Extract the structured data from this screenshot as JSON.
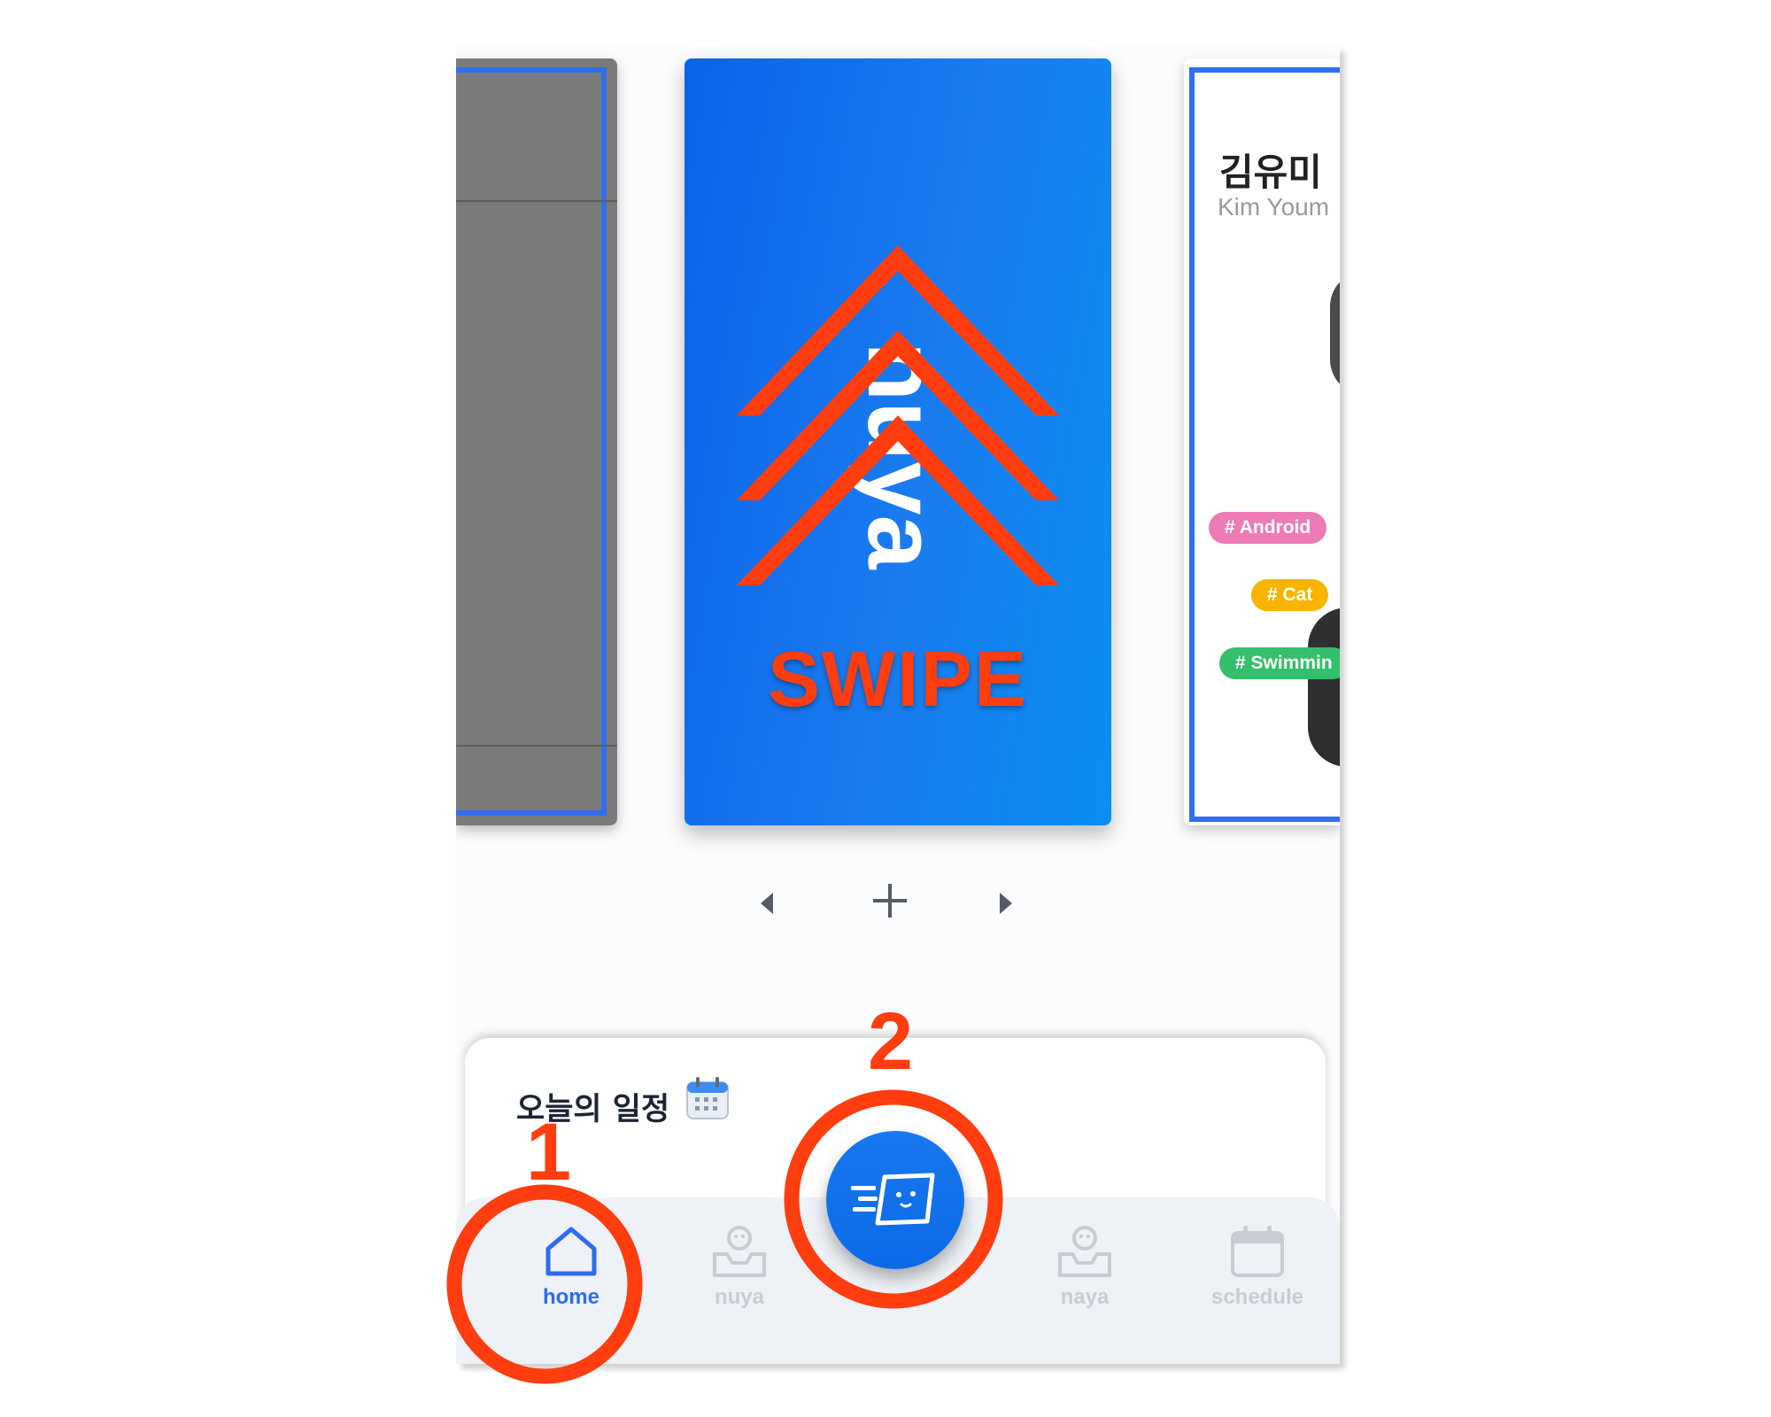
{
  "cards": {
    "center": {
      "wordmark": "nuya",
      "swipe_label": "SWIPE"
    },
    "right": {
      "name_ko": "김유미",
      "name_en": "Kim Youm",
      "tags": [
        "# Android",
        "# Cat",
        "# Swimmin"
      ]
    }
  },
  "controls": {
    "prev_icon": "caret-left-icon",
    "add_icon": "plus-icon",
    "next_icon": "caret-right-icon"
  },
  "schedule_sheet": {
    "title": "오늘의 일정",
    "icon": "calendar-icon"
  },
  "nav": {
    "items": [
      {
        "label": "home",
        "icon": "house-icon",
        "active": true
      },
      {
        "label": "nuya",
        "icon": "inbox-face-icon",
        "active": false
      },
      {
        "label": "naya",
        "icon": "inbox-face-icon",
        "active": false
      },
      {
        "label": "schedule",
        "icon": "calendar-icon",
        "active": false
      }
    ],
    "fab_icon": "speeding-card-icon"
  },
  "annotations": {
    "marker_1": "1",
    "marker_2": "2"
  },
  "colors": {
    "accent": "#2d6cf0",
    "annotation": "#ff3d0e",
    "card_blue": "#0a63e8"
  }
}
